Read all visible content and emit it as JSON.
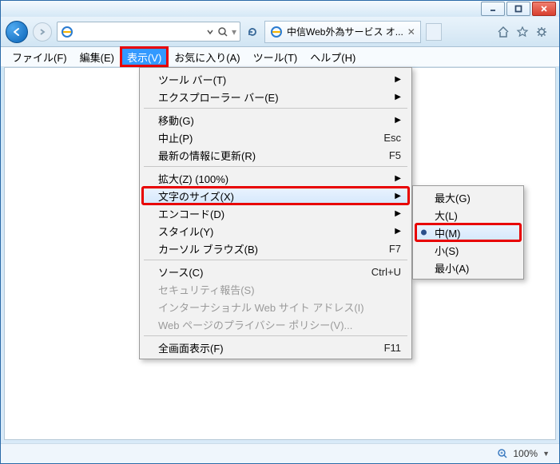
{
  "window": {
    "tab_title": "中信Web外為サービス オ...",
    "address": "",
    "search_placeholder": ""
  },
  "menubar": {
    "file": "ファイル(F)",
    "edit": "編集(E)",
    "view": "表示(V)",
    "favorites": "お気に入り(A)",
    "tools": "ツール(T)",
    "help": "ヘルプ(H)"
  },
  "viewmenu": {
    "toolbars": "ツール バー(T)",
    "explorer_bars": "エクスプローラー バー(E)",
    "goto": "移動(G)",
    "stop": "中止(P)",
    "stop_key": "Esc",
    "refresh": "最新の情報に更新(R)",
    "refresh_key": "F5",
    "zoom": "拡大(Z) (100%)",
    "text_size": "文字のサイズ(X)",
    "encoding": "エンコード(D)",
    "style": "スタイル(Y)",
    "caret": "カーソル ブラウズ(B)",
    "caret_key": "F7",
    "source": "ソース(C)",
    "source_key": "Ctrl+U",
    "security": "セキュリティ報告(S)",
    "intl_addr": "インターナショナル Web サイト アドレス(I)",
    "privacy": "Web ページのプライバシー ポリシー(V)...",
    "fullscreen": "全画面表示(F)",
    "fullscreen_key": "F11"
  },
  "textsize": {
    "largest": "最大(G)",
    "large": "大(L)",
    "medium": "中(M)",
    "small": "小(S)",
    "smallest": "最小(A)"
  },
  "status": {
    "zoom": "100%"
  }
}
